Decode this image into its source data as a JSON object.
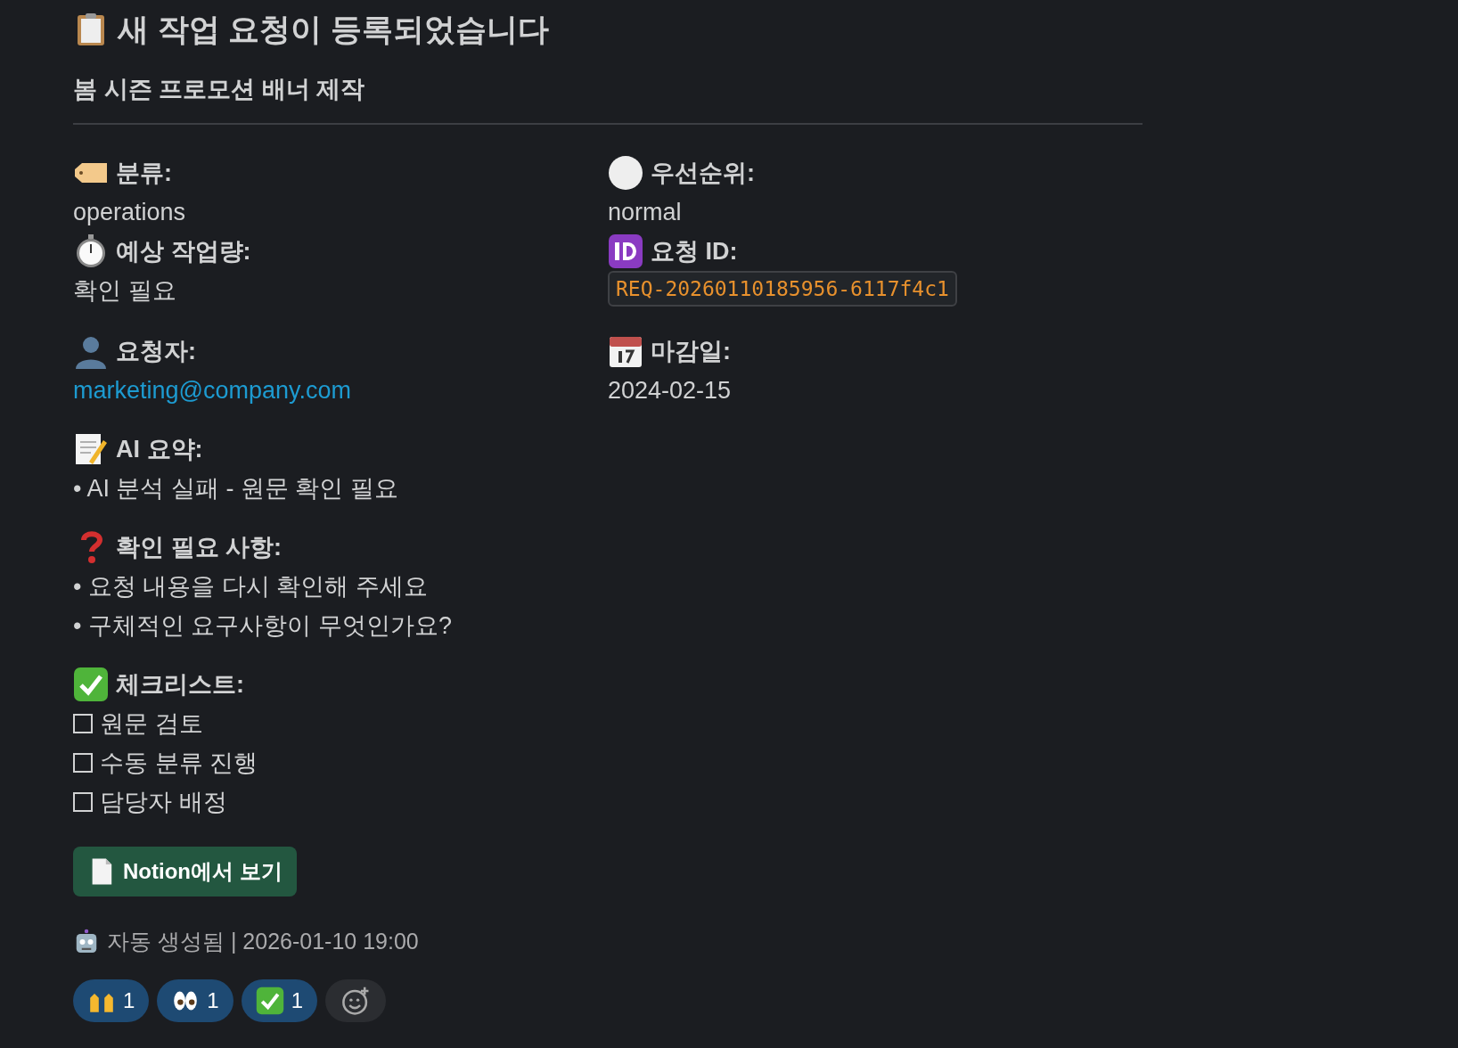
{
  "title": "새 작업 요청이 등록되었습니다",
  "subtitle": "봄 시즌 프로모션 배너 제작",
  "fields": [
    {
      "label": "분류:",
      "value": "operations",
      "kind": "text"
    },
    {
      "label": "우선순위:",
      "value": "normal",
      "kind": "text"
    },
    {
      "label": "예상 작업량:",
      "value": "확인 필요",
      "kind": "text"
    },
    {
      "label": "요청 ID:",
      "value": "REQ-20260110185956-6117f4c1",
      "kind": "code"
    },
    {
      "label": "요청자:",
      "value": "marketing@company.com",
      "kind": "link"
    },
    {
      "label": "마감일:",
      "value": "2024-02-15",
      "kind": "text"
    }
  ],
  "ai_summary": {
    "label": "AI 요약:",
    "bullets": [
      "• AI 분석 실패 - 원문 확인 필요"
    ]
  },
  "questions": {
    "label": "확인 필요 사항:",
    "bullets": [
      "• 요청 내용을 다시 확인해 주세요",
      "• 구체적인 요구사항이 무엇인가요?"
    ]
  },
  "checklist": {
    "label": "체크리스트:",
    "items": [
      {
        "label": "원문 검토",
        "checked": false
      },
      {
        "label": "수동 분류 진행",
        "checked": false
      },
      {
        "label": "담당자 배정",
        "checked": false
      }
    ]
  },
  "button": "Notion에서 보기",
  "footer": "자동 생성됨 | 2026-01-10 19:00",
  "reactions": [
    {
      "count": "1",
      "selected": true
    },
    {
      "count": "1",
      "selected": true
    },
    {
      "count": "1",
      "selected": true
    }
  ]
}
